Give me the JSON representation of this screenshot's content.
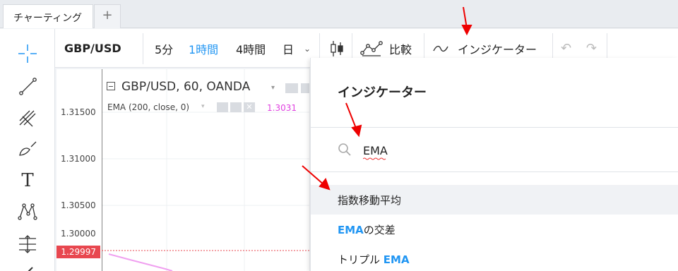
{
  "tabs": {
    "active_label": "チャーティング",
    "add_label": "+"
  },
  "left_toolbar": {
    "icons": [
      "crosshair-icon",
      "trend-line-icon",
      "pitchfork-icon",
      "brush-icon",
      "text-icon",
      "pattern-icon",
      "measure-icon"
    ],
    "text_tool_label": "T"
  },
  "toolbar": {
    "symbol": "GBP/USD",
    "intervals": [
      "5分",
      "1時間",
      "4時間",
      "日"
    ],
    "active_interval": "1時間",
    "compare_label": "比較",
    "indicators_label": "インジケーター"
  },
  "chart": {
    "legend_title": "GBP/USD, 60, OANDA",
    "ema_label": "EMA (200, close, 0)",
    "ema_value": "1.3031",
    "price_labels": [
      "1.31500",
      "1.31000",
      "1.30500",
      "1.30000"
    ],
    "last_price": "1.29997",
    "colors": {
      "ema": "#e040e0",
      "last_price_bg": "#e8474f",
      "accent": "#2196f3"
    }
  },
  "dialog": {
    "title": "インジケーター",
    "search_value": "EMA",
    "results": [
      {
        "text": "指数移動平均",
        "highlight": ""
      },
      {
        "highlight": "EMA",
        "text": "の交差"
      },
      {
        "text": "トリプル ",
        "highlight": "EMA"
      }
    ]
  }
}
